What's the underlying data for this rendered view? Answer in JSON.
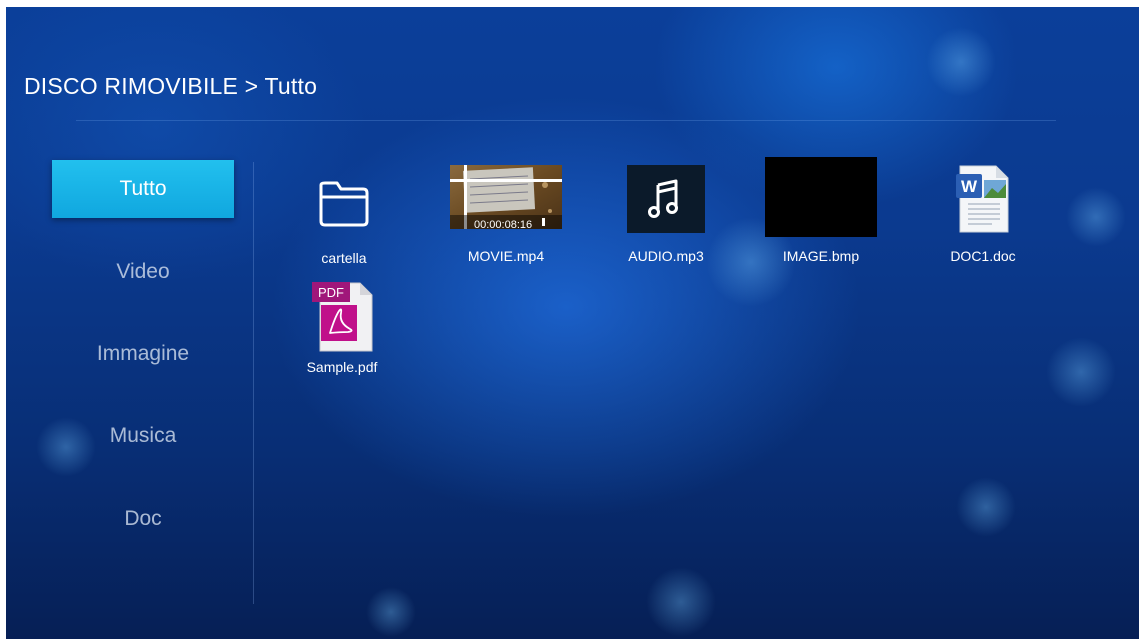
{
  "breadcrumb": {
    "source": "DISCO RIMOVIBILE",
    "separator": ">",
    "current": "Tutto"
  },
  "sidebar": {
    "items": [
      {
        "label": "Tutto",
        "selected": true
      },
      {
        "label": "Video",
        "selected": false
      },
      {
        "label": "Immagine",
        "selected": false
      },
      {
        "label": "Musica",
        "selected": false
      },
      {
        "label": "Doc",
        "selected": false
      }
    ]
  },
  "files": [
    {
      "name": "cartella",
      "icon": "folder-icon"
    },
    {
      "name": "MOVIE.mp4",
      "icon": "video-thumbnail",
      "duration": "00:00:08:16"
    },
    {
      "name": "AUDIO.mp3",
      "icon": "music-note-icon"
    },
    {
      "name": "IMAGE.bmp",
      "icon": "image-thumbnail"
    },
    {
      "name": "DOC1.doc",
      "icon": "word-document-icon",
      "badge": "W"
    },
    {
      "name": "Sample.pdf",
      "icon": "pdf-document-icon",
      "badge": "PDF"
    }
  ],
  "colors": {
    "accent": "#15b2e6",
    "background": "#0b3a8f",
    "pdf": "#b2107f",
    "word": "#2b5fb4"
  }
}
